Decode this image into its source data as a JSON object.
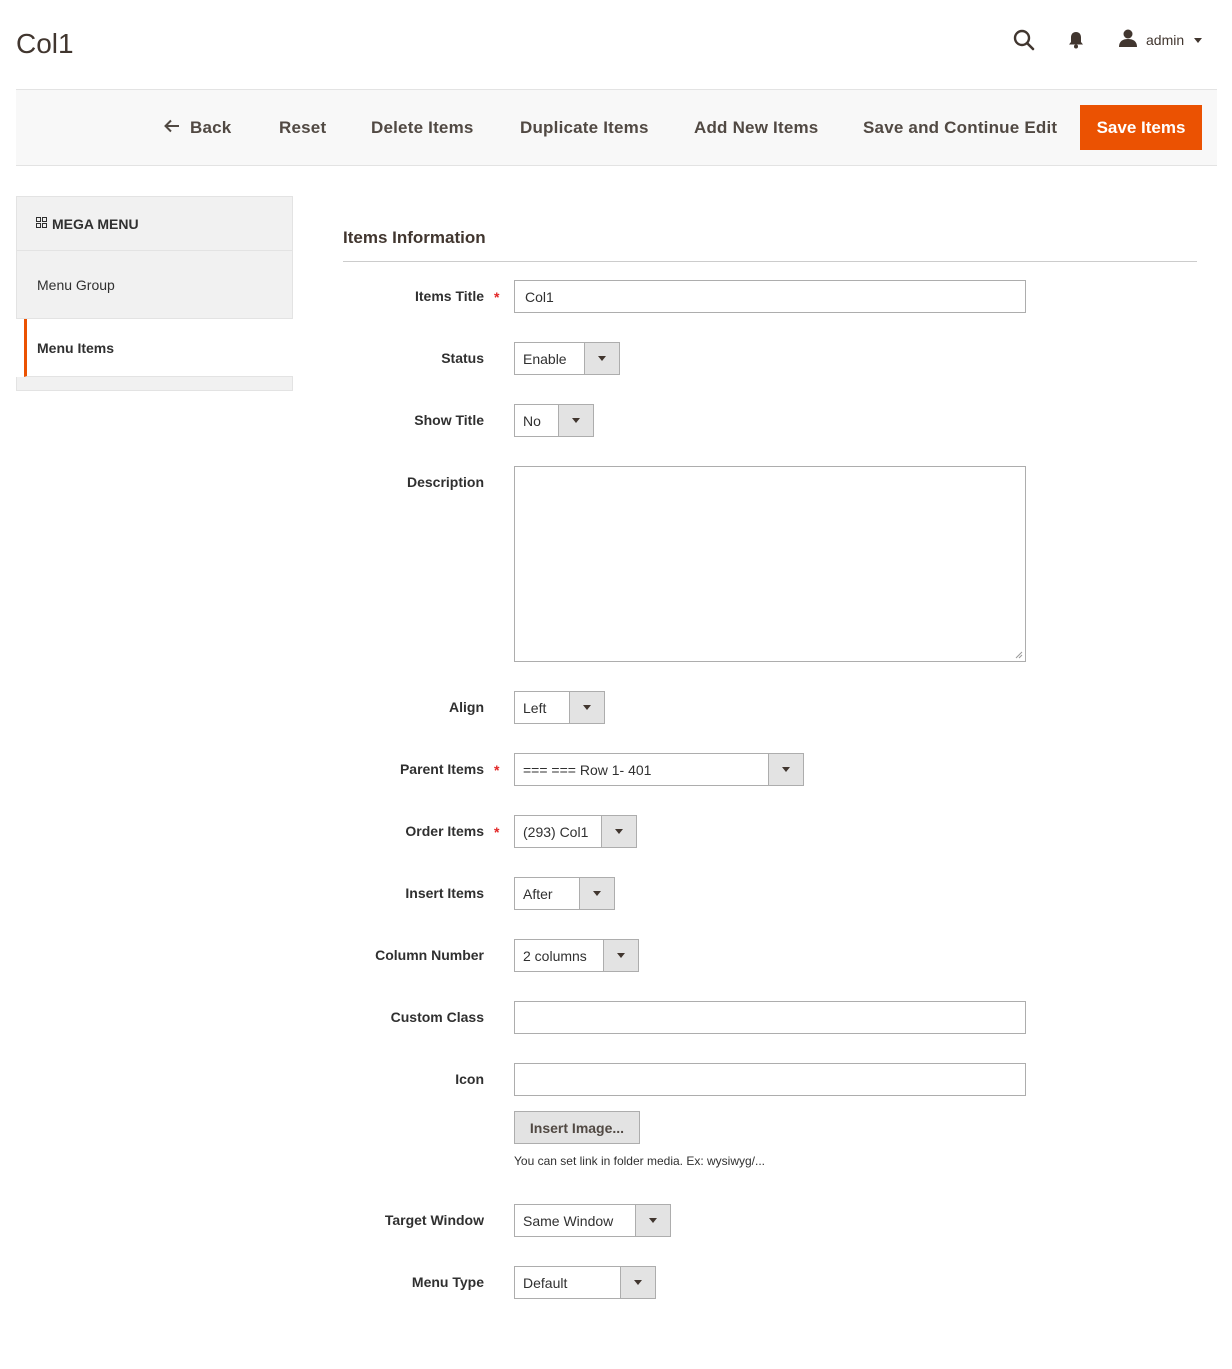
{
  "page": {
    "title": "Col1"
  },
  "header": {
    "user_label": "admin"
  },
  "toolbar": {
    "back": "Back",
    "reset": "Reset",
    "delete": "Delete Items",
    "duplicate": "Duplicate Items",
    "add_new": "Add New Items",
    "save_continue": "Save and Continue Edit",
    "save": "Save Items"
  },
  "sidebar": {
    "heading": "MEGA MENU",
    "items": [
      {
        "label": "Menu Group"
      },
      {
        "label": "Menu Items"
      }
    ]
  },
  "form": {
    "section_title": "Items Information",
    "required_mark": "*",
    "fields": {
      "items_title": {
        "label": "Items Title",
        "value": "Col1"
      },
      "status": {
        "label": "Status",
        "value": "Enable"
      },
      "show_title": {
        "label": "Show Title",
        "value": "No"
      },
      "description": {
        "label": "Description",
        "value": ""
      },
      "align": {
        "label": "Align",
        "value": "Left"
      },
      "parent_items": {
        "label": "Parent Items",
        "value": "=== === Row 1- 401"
      },
      "order_items": {
        "label": "Order Items",
        "value": "(293) Col1"
      },
      "insert_items": {
        "label": "Insert Items",
        "value": "After"
      },
      "column_number": {
        "label": "Column Number",
        "value": "2 columns"
      },
      "custom_class": {
        "label": "Custom Class",
        "value": ""
      },
      "icon": {
        "label": "Icon",
        "value": ""
      },
      "target_window": {
        "label": "Target Window",
        "value": "Same Window"
      },
      "menu_type": {
        "label": "Menu Type",
        "value": "Default"
      }
    },
    "insert_image_button": "Insert Image...",
    "icon_note": "You can set link in folder media. Ex: wysiwyg/..."
  },
  "colors": {
    "accent": "#eb5202",
    "required": "#e22626",
    "text": "#303030"
  }
}
